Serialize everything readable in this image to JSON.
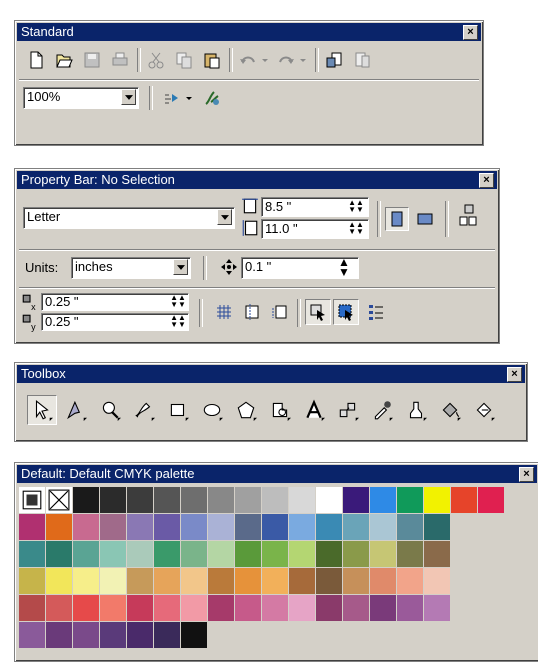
{
  "standard": {
    "title": "Standard",
    "close": "×",
    "tools": [
      {
        "name": "new-document-icon"
      },
      {
        "name": "open-icon"
      },
      {
        "name": "save-icon"
      },
      {
        "name": "print-icon"
      },
      {
        "name": "cut-icon"
      },
      {
        "name": "copy-icon"
      },
      {
        "name": "paste-icon"
      },
      {
        "name": "undo-icon"
      },
      {
        "name": "redo-icon"
      },
      {
        "name": "import-icon"
      },
      {
        "name": "export-icon"
      }
    ],
    "zoom_value": "100%"
  },
  "property_bar": {
    "title": "Property Bar: No Selection",
    "close": "×",
    "paper_size": "Letter",
    "width": "8.5 \"",
    "height": "11.0 \"",
    "units_label": "Units:",
    "units_value": "inches",
    "nudge": "0.1 \"",
    "dup_x": "0.25 \"",
    "dup_y": "0.25 \""
  },
  "toolbox": {
    "title": "Toolbox",
    "close": "×",
    "tools": [
      {
        "name": "pick-tool-icon"
      },
      {
        "name": "shape-tool-icon"
      },
      {
        "name": "zoom-tool-icon"
      },
      {
        "name": "freehand-tool-icon"
      },
      {
        "name": "rectangle-tool-icon"
      },
      {
        "name": "ellipse-tool-icon"
      },
      {
        "name": "polygon-tool-icon"
      },
      {
        "name": "basic-shapes-tool-icon"
      },
      {
        "name": "text-tool-icon"
      },
      {
        "name": "interactive-blend-tool-icon"
      },
      {
        "name": "eyedropper-tool-icon"
      },
      {
        "name": "outline-tool-icon"
      },
      {
        "name": "fill-tool-icon"
      },
      {
        "name": "interactive-fill-tool-icon"
      }
    ]
  },
  "palette": {
    "title": "Default: Default CMYK palette",
    "close": "×",
    "rows": [
      [
        "#1a1a1a",
        "#2b2b2b",
        "#3c3c3c",
        "#555555",
        "#6e6e6e",
        "#888888",
        "#a0a0a0",
        "#bdbdbd",
        "#d8d8d8",
        "#ffffff",
        "#3a1a7a",
        "#2e8ae6",
        "#109a5a",
        "#f2f200",
        "#e6442a",
        "#e02050"
      ],
      [
        "#b03070",
        "#e06a1a",
        "#c86a90",
        "#a06a8a",
        "#8a78b4",
        "#6a5aa6",
        "#7a8ac8",
        "#aab2d6",
        "#5a6a8a",
        "#3a5aa6",
        "#7aaae0",
        "#3a8ab4",
        "#6aa4b8",
        "#aac6d4",
        "#5a8a9a",
        "#2a6a6a"
      ],
      [
        "#3a8a8a",
        "#2a7a6a",
        "#5aa494",
        "#8ac6b4",
        "#aacaba",
        "#3a9a6a",
        "#7ab48a",
        "#b4d6a4",
        "#5a9a3a",
        "#7ab44a",
        "#b4d672",
        "#4a6a2a",
        "#8a9a4a",
        "#c6c674",
        "#7a7a4a",
        "#8a6a4a"
      ],
      [
        "#c6b44a",
        "#f2e65a",
        "#f6ee8a",
        "#f2f2b4",
        "#c69a5a",
        "#e6a45a",
        "#f2c68a",
        "#ba7a3a",
        "#e6923a",
        "#f2b05a",
        "#a66a3a",
        "#7a5a3a",
        "#c6905a",
        "#e08a6a",
        "#f2a48a",
        "#f2c6b4"
      ],
      [
        "#b44a4a",
        "#d45a5a",
        "#e64a4a",
        "#f27a6a",
        "#c63a5a",
        "#e66a7a",
        "#f29aa6",
        "#a63a6a",
        "#c65a8a",
        "#d47aa4",
        "#e6a4c6",
        "#8a3a6a",
        "#a65a8a",
        "#7a3a7a",
        "#9a5a9a",
        "#b47ab4"
      ],
      [
        "#8a5a9a",
        "#6a3a7a",
        "#7a4a8a",
        "#5a3a7a",
        "#4a2a6a",
        "#3a2a5a",
        "#111111"
      ]
    ]
  }
}
